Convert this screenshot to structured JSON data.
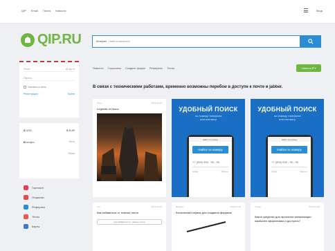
{
  "topnav": {
    "items": [
      "QIP",
      "Email",
      "Почта",
      "Новости"
    ],
    "login": "Вход"
  },
  "logo": {
    "text": "QIP.RU"
  },
  "search": {
    "scope": "Интернет",
    "placeholder": "Найти в интернете"
  },
  "login_box": {
    "login_label": "Логин",
    "domain": "@ qip.ru",
    "password_label": "Пароль",
    "remember": "Запомнить меня",
    "register": "Регистрация",
    "enter": "Войти"
  },
  "rates": {
    "usd_symbol": "$",
    "usd_value": "USD",
    "eur_symbol": "€",
    "eur_value": "EUR",
    "oil_symbol": "B",
    "oil_value": "нефть",
    "oil_sub": "Brent",
    "extra_sub": "Biржа"
  },
  "services": [
    {
      "label": "Гороскоп",
      "color": "#e0405a"
    },
    {
      "label": "Открытки",
      "color": "#e24c4c"
    },
    {
      "label": "Рефераты",
      "color": "#2b8ed3"
    },
    {
      "label": "Тесты",
      "color": "#e95c4c"
    },
    {
      "label": "Карты",
      "color": "#3a79c9"
    }
  ],
  "subnav": [
    "Новости",
    "Гороскопы",
    "Создать форум",
    "Рефераты",
    "Тесты"
  ],
  "green_button": "Сменить IP ▾",
  "headline": "В связи с техническими работами, временно возможны перебои в доступе к почте и jabber.",
  "game_card": {
    "category": "Игры",
    "date": "2019-07-25",
    "title": "Legends of Honor"
  },
  "ads": [
    {
      "title": "УДОБНЫЙ ПОИСК",
      "subtitle_1": "по номеру телефона",
      "subtitle_2": "или контакту",
      "phone_bar": "Найти по номеру",
      "phone_button": "Найти по номеру",
      "phone_number": "+7 (999) 999 - 99 - 99",
      "phone_foot_left": "Назад",
      "phone_foot_right": "Закрыть"
    },
    {
      "title": "УДОБНЫЙ ПОИСК",
      "subtitle_1": "по номеру телефона",
      "subtitle_2": "или контакту",
      "phone_bar": "Найти по номеру",
      "phone_button": "Найти по номеру",
      "phone_number": "+7 (999) 999 - 99 - 99",
      "phone_foot_left": "Назад",
      "phone_foot_right": "Закрыть"
    }
  ],
  "bottom_cards": [
    {
      "category": "Хит",
      "date": "2019-07-25",
      "text": "Как избавиться от темных пятен",
      "pill": "Как избавиться от темных пятен"
    },
    {
      "category": "Форумы",
      "date": "2019-07-25",
      "text": "Бесплатный сервис для создания форумов",
      "pill": ""
    },
    {
      "category": "Отзыв",
      "date": "2019-07-25",
      "text": "Какое средство для прочистки канализации наиболее эффективно и доступно?",
      "pill": ""
    }
  ]
}
